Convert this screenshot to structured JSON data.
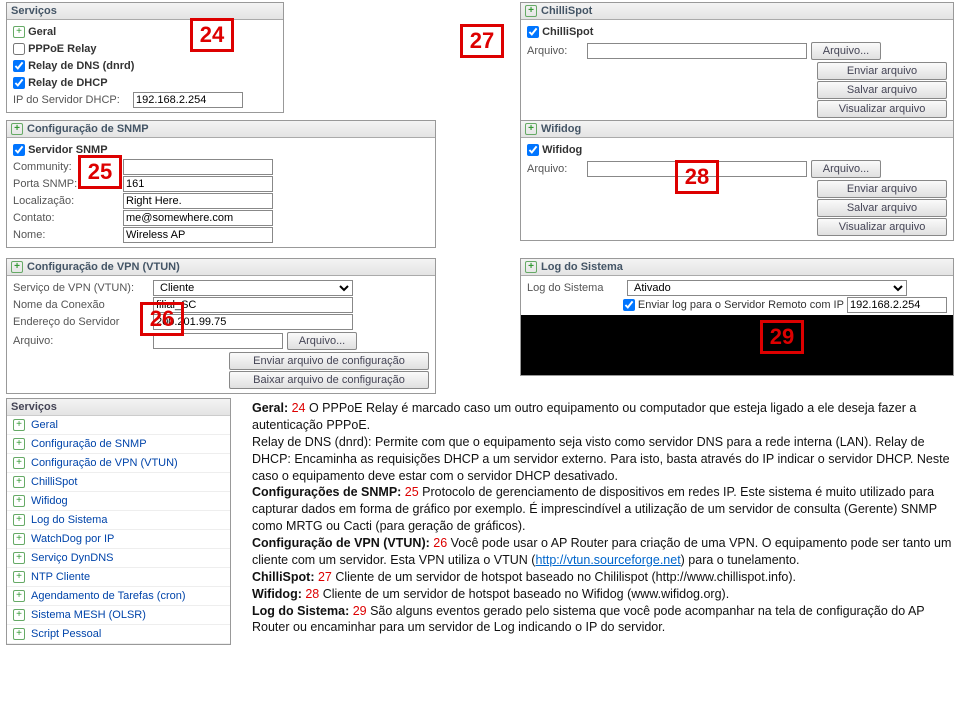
{
  "callouts": {
    "c24": "24",
    "c25": "25",
    "c26": "26",
    "c27": "27",
    "c28": "28",
    "c29": "29"
  },
  "servicos": {
    "title": "Serviços",
    "geral": "Geral",
    "pppoe": "PPPoE Relay",
    "dnrd": "Relay de DNS (dnrd)",
    "dhcp_relay": "Relay de DHCP",
    "dhcp_ip_label": "IP do Servidor DHCP:",
    "dhcp_ip": "192.168.2.254"
  },
  "snmp": {
    "title": "Configuração de SNMP",
    "servidor": "Servidor SNMP",
    "community": "Community:",
    "porta_label": "Porta SNMP:",
    "porta": "161",
    "local_label": "Localização:",
    "local": "Right Here.",
    "contato_label": "Contato:",
    "contato": "me@somewhere.com",
    "nome_label": "Nome:",
    "nome": "Wireless AP"
  },
  "vtun": {
    "title": "Configuração de VPN (VTUN)",
    "servico_label": "Serviço de VPN (VTUN):",
    "servico": "Cliente",
    "nome_label": "Nome da Conexão",
    "nome": "filial_SC",
    "end_label": "Endereço do Servidor",
    "end": "200.201.99.75",
    "arquivo_label": "Arquivo:",
    "btn_arquivo": "Arquivo...",
    "btn_enviar": "Enviar arquivo de configuração",
    "btn_baixar": "Baixar arquivo de configuração"
  },
  "chilli": {
    "title": "ChilliSpot",
    "sub": "ChilliSpot",
    "arquivo_label": "Arquivo:",
    "btn_arquivo": "Arquivo...",
    "btn_enviar": "Enviar arquivo",
    "btn_salvar": "Salvar arquivo",
    "btn_vis": "Visualizar arquivo"
  },
  "wifidog": {
    "title": "Wifidog",
    "sub": "Wifidog",
    "arquivo_label": "Arquivo:",
    "btn_arquivo": "Arquivo...",
    "btn_enviar": "Enviar arquivo",
    "btn_salvar": "Salvar arquivo",
    "btn_vis": "Visualizar arquivo"
  },
  "log": {
    "title": "Log do Sistema",
    "label": "Log do Sistema",
    "ativado": "Ativado",
    "enviar_label": "Enviar log para o Servidor Remoto com IP",
    "ip": "192.168.2.254"
  },
  "sidebar": {
    "title": "Serviços",
    "items": [
      "Geral",
      "Configuração de SNMP",
      "Configuração de VPN (VTUN)",
      "ChilliSpot",
      "Wifidog",
      "Log do Sistema",
      "WatchDog por IP",
      "Serviço DynDNS",
      "NTP Cliente",
      "Agendamento de Tarefas (cron)",
      "Sistema MESH (OLSR)",
      "Script Pessoal"
    ]
  },
  "desc": {
    "p1a": "Geral: ",
    "p1n": "24",
    "p1b": " O PPPoE Relay é marcado caso um outro equipamento ou computador que esteja ligado a ele deseja fazer a autenticação PPPoE.",
    "p2": "Relay de DNS (dnrd): Permite com que o equipamento seja visto como servidor DNS para a rede interna (LAN). Relay de DHCP: Encaminha as requisições DHCP a um servidor externo. Para isto, basta através do IP indicar o servidor DHCP. Neste caso o equipamento deve estar com o servidor DHCP desativado.",
    "p3a": "Configurações de SNMP: ",
    "p3n": "25",
    "p3b": " Protocolo de gerenciamento de dispositivos em redes IP. Este sistema é muito utilizado para capturar dados em forma de gráfico por exemplo. É imprescindível a utilização de um servidor de consulta (Gerente) SNMP como MRTG ou Cacti (para geração de gráficos).",
    "p4a": "Configuração de VPN (VTUN): ",
    "p4n": "26",
    "p4b": " Você pode usar o AP Router para criação de uma VPN. O equipamento pode ser tanto um cliente com um servidor. Esta VPN utiliza o VTUN (",
    "p4l": "http://vtun.sourceforge.net",
    "p4c": ") para o tunelamento.",
    "p5a": "ChilliSpot: ",
    "p5n": "27",
    "p5b": " Cliente de um servidor de hotspot baseado no Chililispot (http://www.chillispot.info).",
    "p6a": "Wifidog: ",
    "p6n": "28",
    "p6b": " Cliente de um servidor de hotspot baseado no Wifidog (www.wifidog.org).",
    "p7a": "Log do Sistema: ",
    "p7n": "29",
    "p7b": " São alguns eventos gerado pelo sistema que você pode acompanhar na tela de configuração do AP Router ou encaminhar para um servidor de Log indicando o IP do servidor."
  }
}
